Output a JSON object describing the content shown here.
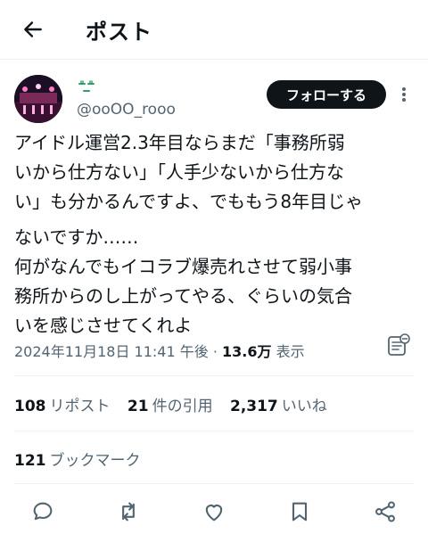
{
  "header": {
    "title": "ポスト"
  },
  "author": {
    "display_name_emoji": "expressionless-face-emoji",
    "handle": "@ooOO_rooo"
  },
  "follow_label": "フォローする",
  "tweet": {
    "lines": [
      "アイドル運営2.3年目ならまだ「事務所弱",
      "いから仕方ない」「人手少ないから仕方な",
      "い」も分かるんですよ、でももう8年目じゃ",
      "ないですか……",
      "何がなんでもイコラブ爆売れさせて弱小事",
      "務所からのし上がってやる、ぐらいの気合",
      "いを感じさせてくれよ"
    ]
  },
  "meta": {
    "timestamp": "2024年11月18日 11:41 午後",
    "separator": "·",
    "views_count": "13.6万",
    "views_label": "表示"
  },
  "stats": {
    "reposts_count": "108",
    "reposts_label": "リポスト",
    "quotes_count": "21",
    "quotes_label": "件の引用",
    "likes_count": "2,317",
    "likes_label": "いいね"
  },
  "bookmarks": {
    "count": "121",
    "label": "ブックマーク"
  },
  "actions": [
    "reply-icon",
    "repost-icon",
    "like-icon",
    "bookmark-icon",
    "share-icon"
  ],
  "colors": {
    "text": "#0f1419",
    "secondary": "#536471",
    "divider": "#eff3f4",
    "follow_bg": "#0f1419"
  }
}
